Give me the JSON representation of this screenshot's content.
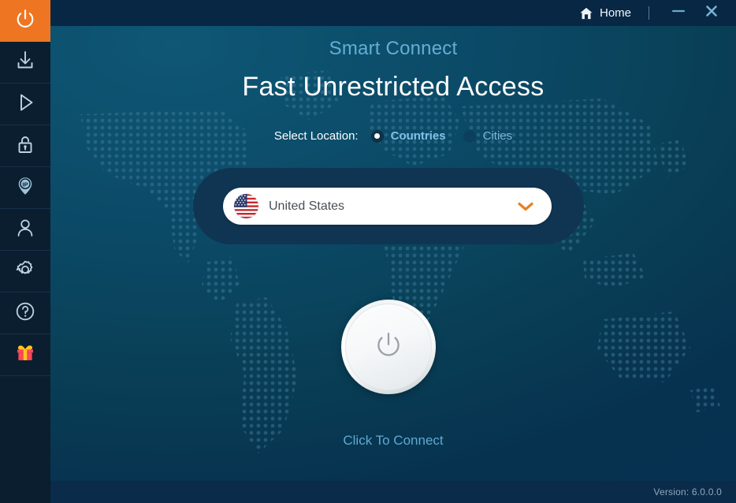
{
  "titlebar": {
    "home_label": "Home",
    "home_icon": "home-icon",
    "minimize_icon": "minimize-icon",
    "close_icon": "close-icon"
  },
  "sidebar": {
    "items": [
      {
        "name": "power",
        "icon": "power-icon",
        "active": true
      },
      {
        "name": "download",
        "icon": "download-icon",
        "active": false
      },
      {
        "name": "play",
        "icon": "play-icon",
        "active": false
      },
      {
        "name": "unlock",
        "icon": "unlock-padlock-icon",
        "active": false
      },
      {
        "name": "ip",
        "icon": "ip-location-pin-icon",
        "active": false
      },
      {
        "name": "account",
        "icon": "user-icon",
        "active": false
      },
      {
        "name": "settings",
        "icon": "gear-icon",
        "active": false
      },
      {
        "name": "help",
        "icon": "question-circle-icon",
        "active": false
      },
      {
        "name": "gift",
        "icon": "gift-icon",
        "active": false
      }
    ]
  },
  "main": {
    "subtitle": "Smart Connect",
    "headline": "Fast Unrestricted Access",
    "location": {
      "label": "Select Location:",
      "options": [
        {
          "label": "Countries",
          "selected": true
        },
        {
          "label": "Cities",
          "selected": false
        }
      ]
    },
    "dropdown": {
      "value": "United States",
      "flag_icon": "us-flag-icon",
      "chevron_icon": "chevron-down-icon"
    },
    "connect": {
      "button_icon": "power-icon",
      "caption": "Click To Connect"
    }
  },
  "footer": {
    "version_text": "Version:  6.0.0.0"
  },
  "colors": {
    "accent_orange": "#ee7623",
    "chevron_orange": "#e8801e",
    "link_blue": "#5fa9d2",
    "subtitle_blue": "#64aed4",
    "titlebar_navy": "#082744",
    "sidebar_navy": "#0b1e2f",
    "footer_navy": "#0a2b4a"
  }
}
